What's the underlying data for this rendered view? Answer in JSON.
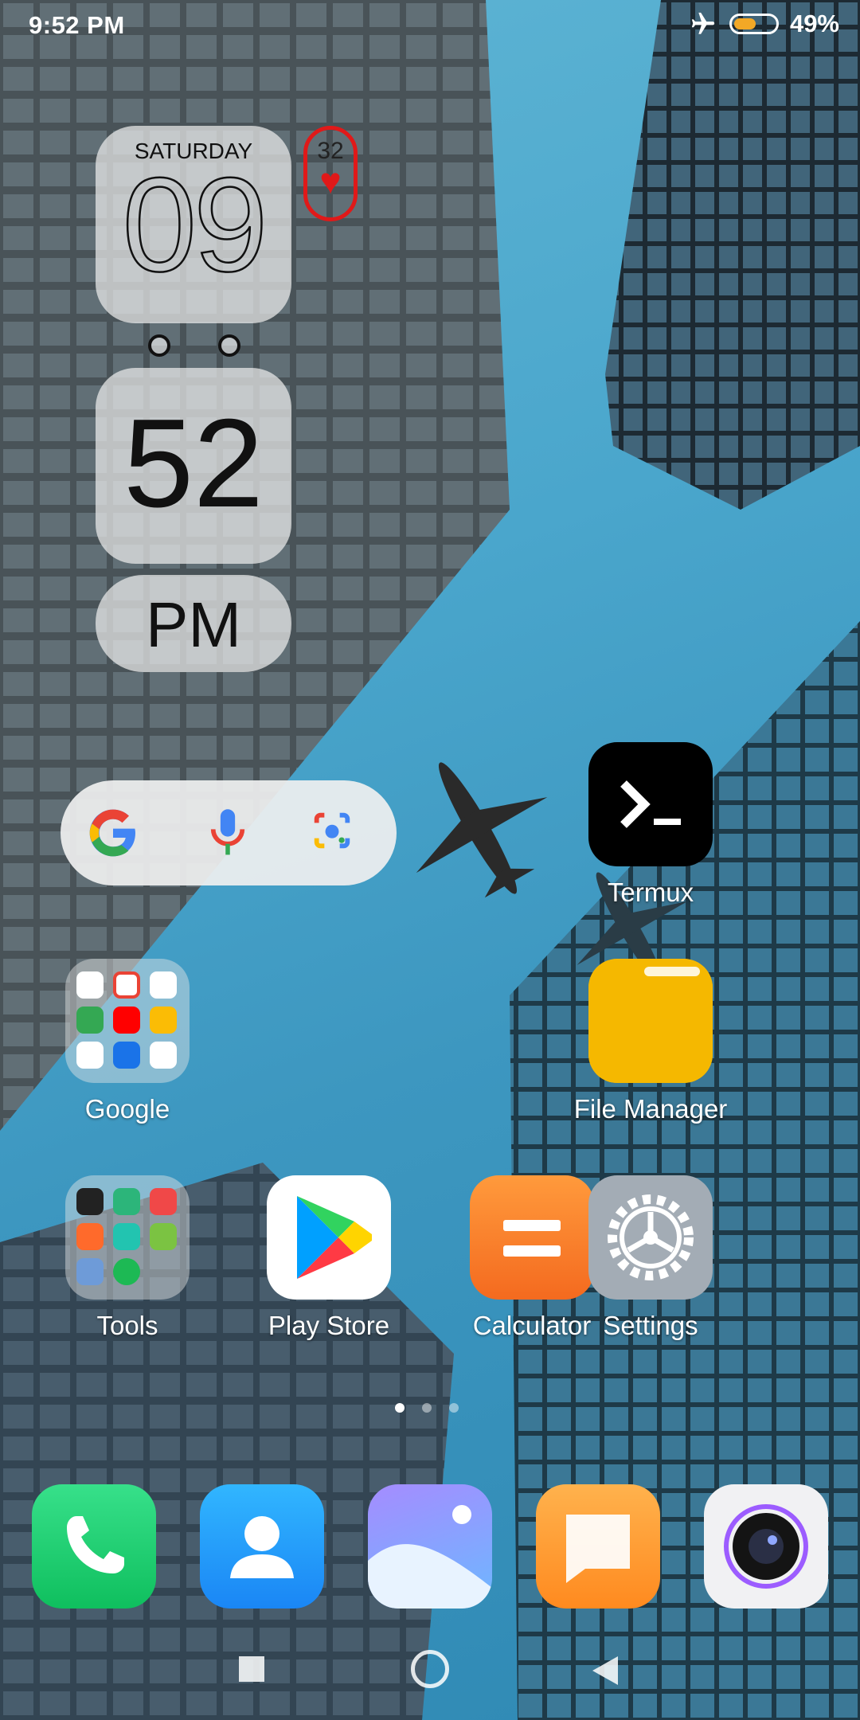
{
  "status_bar": {
    "time": "9:52 PM",
    "battery_percent": "49%",
    "battery_level": 0.49,
    "airplane_mode": true
  },
  "clock_widget": {
    "day_name": "SATURDAY",
    "hour": "09",
    "minute": "52",
    "ampm": "PM"
  },
  "heart_widget": {
    "value": "32",
    "icon": "heart-icon",
    "color": "#e01919"
  },
  "search_widget": {
    "icons": [
      "google-logo-icon",
      "microphone-icon",
      "google-lens-icon"
    ]
  },
  "apps": {
    "termux": {
      "label": "Termux"
    },
    "file_manager": {
      "label": "File Manager"
    },
    "google_folder": {
      "label": "Google"
    },
    "tools_folder": {
      "label": "Tools"
    },
    "play_store": {
      "label": "Play Store"
    },
    "calculator": {
      "label": "Calculator"
    },
    "settings": {
      "label": "Settings"
    }
  },
  "dock": [
    "phone-icon",
    "contacts-icon",
    "gallery-icon",
    "messages-icon",
    "camera-icon"
  ],
  "pager": {
    "pages": 3,
    "active": 1
  },
  "nav": [
    "recents-button",
    "home-button",
    "back-button"
  ]
}
